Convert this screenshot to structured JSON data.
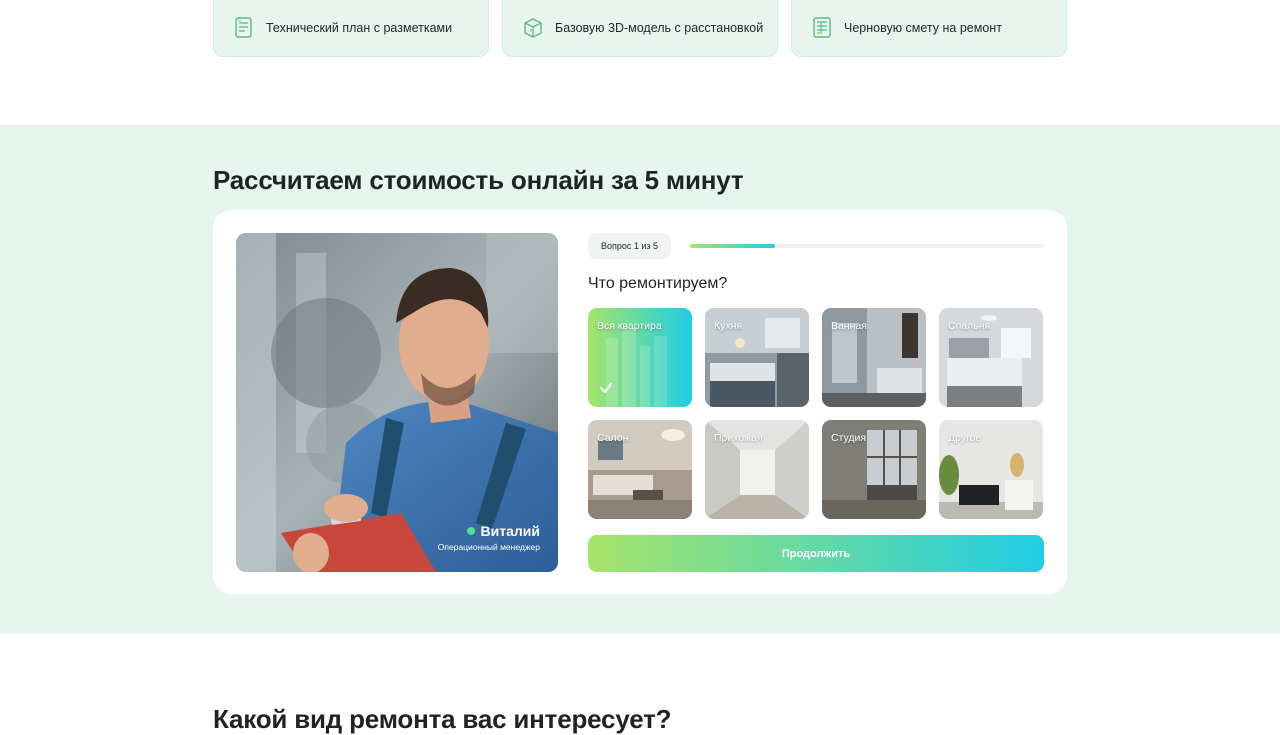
{
  "features": [
    {
      "label": "Технический план с разметками",
      "icon": "plan-icon"
    },
    {
      "label": "Базовую 3D-модель с расстановкой",
      "icon": "3d-box-icon"
    },
    {
      "label": "Черновую смету на ремонт",
      "icon": "estimate-icon"
    }
  ],
  "calculator": {
    "title": "Рассчитаем стоимость онлайн за 5 минут",
    "manager": {
      "name": "Виталий",
      "role": "Операционный менеджер"
    },
    "step_label": "Вопрос 1 из 5",
    "progress": 0.24,
    "question": "Что ремонтируем?",
    "options": [
      {
        "label": "Вся квартира",
        "selected": true
      },
      {
        "label": "Кухня",
        "selected": false
      },
      {
        "label": "Ванная",
        "selected": false
      },
      {
        "label": "Спальня",
        "selected": false
      },
      {
        "label": "Салон",
        "selected": false
      },
      {
        "label": "Прихожая",
        "selected": false
      },
      {
        "label": "Студия",
        "selected": false
      },
      {
        "label": "Другое",
        "selected": false
      }
    ],
    "continue_label": "Продолжить"
  },
  "next_section": {
    "title": "Какой вид ремонта вас интересует?"
  },
  "colors": {
    "accent_start": "#a6e46a",
    "accent_end": "#1fcde4",
    "section_bg": "#e6f5ee",
    "icon_green": "#5cb88a"
  }
}
